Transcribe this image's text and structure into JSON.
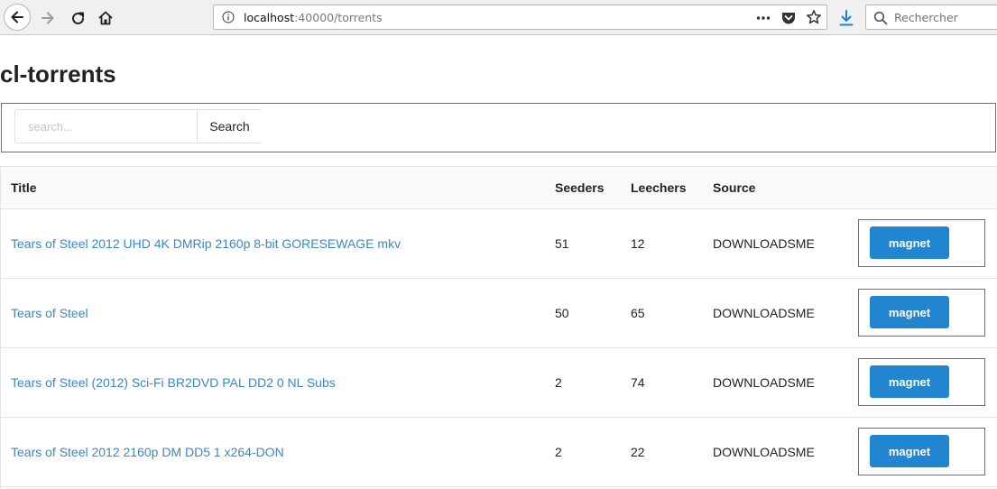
{
  "browser": {
    "url_host": "localhost",
    "url_rest": ":40000/torrents",
    "search_placeholder": "Rechercher"
  },
  "page": {
    "title": "cl-torrents"
  },
  "search": {
    "placeholder": "search...",
    "button_label": "Search"
  },
  "table": {
    "headers": {
      "title": "Title",
      "seeders": "Seeders",
      "leechers": "Leechers",
      "source": "Source"
    },
    "rows": [
      {
        "title": "Tears of Steel 2012 UHD 4K DMRip 2160p 8-bit GORESEWAGE mkv",
        "seeders": "51",
        "leechers": "12",
        "source": "DOWNLOADSME",
        "action": "magnet"
      },
      {
        "title": "Tears of Steel",
        "seeders": "50",
        "leechers": "65",
        "source": "DOWNLOADSME",
        "action": "magnet"
      },
      {
        "title": "Tears of Steel (2012) Sci-Fi BR2DVD PAL DD2 0 NL Subs",
        "seeders": "2",
        "leechers": "74",
        "source": "DOWNLOADSME",
        "action": "magnet"
      },
      {
        "title": "Tears of Steel 2012 2160p DM DD5 1 x264-DON",
        "seeders": "2",
        "leechers": "22",
        "source": "DOWNLOADSME",
        "action": "magnet"
      }
    ]
  },
  "colors": {
    "link": "#3d86c6",
    "primary_button": "#2185d0",
    "header_bg": "#f8f9fa"
  }
}
